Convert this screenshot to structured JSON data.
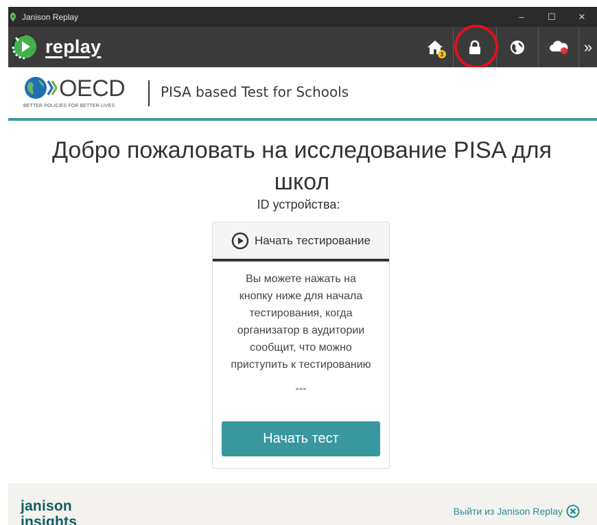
{
  "window": {
    "title": "Janison Replay",
    "minimize_glyph": "–",
    "maximize_glyph": "☐",
    "close_glyph": "✕"
  },
  "toolbar": {
    "logo_text": "replay",
    "home_badge": "3",
    "overflow_glyph": "»",
    "icons": [
      "home-icon",
      "lock-icon",
      "globe-icon",
      "cloud-icon"
    ]
  },
  "header": {
    "oecd_word": "OECD",
    "oecd_tagline": "BETTER POLICIES FOR BETTER LIVES",
    "product": "PISA based Test for Schools"
  },
  "main": {
    "welcome_line1": "Добро пожаловать на исследование PISA для",
    "welcome_line2": "школ",
    "device_id_label": "ID устройства:",
    "card": {
      "header": "Начать тестирование",
      "body_lines": [
        "Вы можете нажать на",
        "кнопку ниже для начала",
        "тестирования, когда",
        "организатор в аудитории",
        "сообщит, что можно",
        "приступить к тестированию"
      ],
      "dash": "---",
      "button": "Начать тест"
    }
  },
  "footer": {
    "brand_line1": "janison",
    "brand_line2": "insights",
    "exit_link": "Выйти из Janison Replay"
  },
  "colors": {
    "toolbar": "#3b3b3b",
    "titlebar": "#2b2b2b",
    "accent": "#39979f",
    "highlight_ring": "#e0101b",
    "badge": "#f2c21b"
  }
}
